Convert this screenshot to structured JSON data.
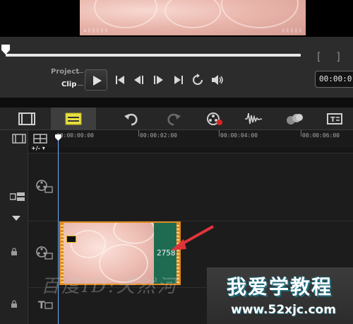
{
  "preview": {
    "caption_left": "© ░ ░ ░ ░ ░",
    "caption_right": "░ ░ ░ ░ ░"
  },
  "player": {
    "mode_project": "Project",
    "mode_clip": "Clip",
    "mark_in": "[",
    "mark_out": "]",
    "timecode": "00:00:0",
    "icons": {
      "play": "play-icon",
      "home": "go-to-start-icon",
      "prev_frame": "previous-frame-icon",
      "next_frame": "next-frame-icon",
      "end": "go-to-end-icon",
      "repeat": "repeat-icon",
      "volume": "volume-icon"
    }
  },
  "toolbar": {
    "icons": [
      "storyboard-view-icon",
      "timeline-view-icon",
      "undo-icon",
      "redo-icon",
      "record-capture-icon",
      "sound-mixer-icon",
      "auto-music-icon",
      "title-icon"
    ]
  },
  "ruler": {
    "labels": [
      "00:00:00:00",
      "00:00:02:00",
      "00:00:04:00",
      "00:00:06:00"
    ],
    "add_remove": "+/- ▾"
  },
  "clip": {
    "number": "2758"
  },
  "watermarks": {
    "left": "百度ID:天然河",
    "title": "我爱学教程",
    "url": "www.52xjc.com"
  },
  "colors": {
    "clip_border": "#e08a1e",
    "clip_green": "#1f6b52",
    "playhead": "#6ab0ff",
    "arrow": "#e0343a",
    "timeline_button_active": "#e8e040"
  }
}
